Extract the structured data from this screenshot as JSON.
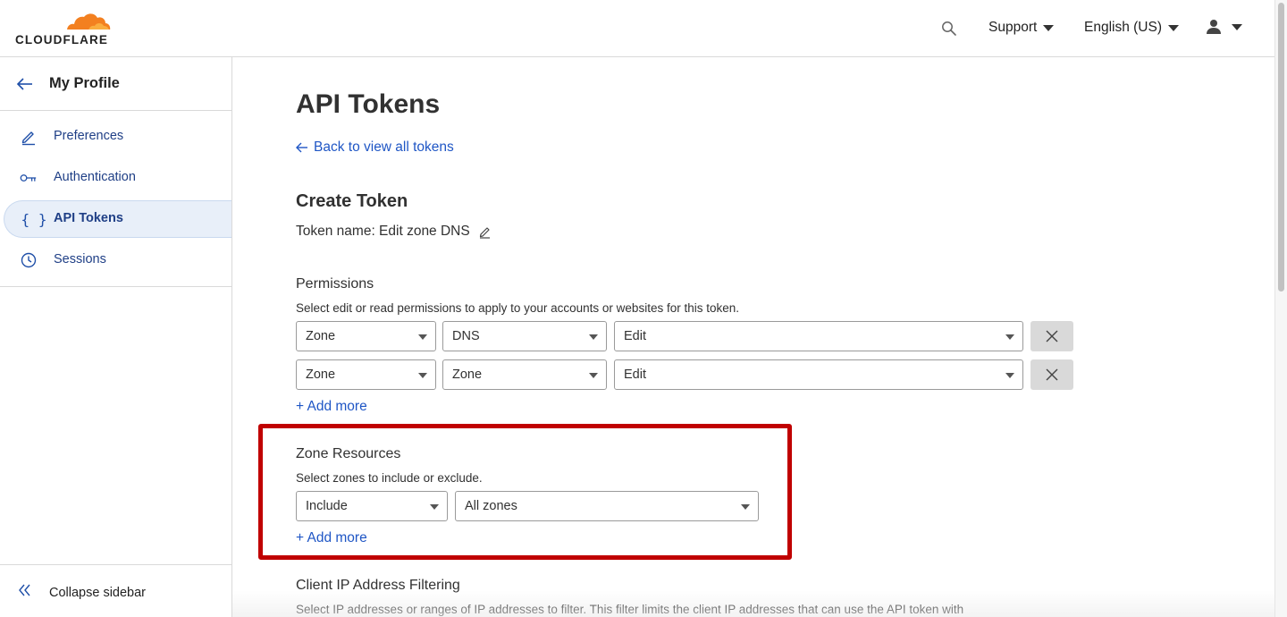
{
  "header": {
    "brand": "CLOUDFLARE",
    "support_label": "Support",
    "language_label": "English (US)",
    "icons": [
      "search-icon",
      "user-icon"
    ]
  },
  "sidebar": {
    "title": "My Profile",
    "items": [
      {
        "label": "Preferences",
        "icon": "pencil-icon",
        "active": false
      },
      {
        "label": "Authentication",
        "icon": "key-icon",
        "active": false
      },
      {
        "label": "API Tokens",
        "icon": "braces-icon",
        "active": true
      },
      {
        "label": "Sessions",
        "icon": "clock-icon",
        "active": false
      }
    ],
    "collapse_label": "Collapse sidebar"
  },
  "main": {
    "page_title": "API Tokens",
    "back_link": "Back to view all tokens",
    "section_title": "Create Token",
    "token_name": "Token name: Edit zone DNS",
    "permissions": {
      "label": "Permissions",
      "description": "Select edit or read permissions to apply to your accounts or websites for this token.",
      "rows": [
        {
          "scope": "Zone",
          "resource": "DNS",
          "access": "Edit"
        },
        {
          "scope": "Zone",
          "resource": "Zone",
          "access": "Edit"
        }
      ],
      "add_more": "+ Add more"
    },
    "zone_resources": {
      "label": "Zone Resources",
      "description": "Select zones to include or exclude.",
      "mode": "Include",
      "target": "All zones",
      "add_more": "+ Add more"
    },
    "client_ip": {
      "label": "Client IP Address Filtering",
      "description": "Select IP addresses or ranges of IP addresses to filter. This filter limits the client IP addresses that can use the API token with"
    }
  },
  "colors": {
    "link": "#1f56c5",
    "highlight": "#c00000",
    "brand_orange": "#f38020",
    "sidebar_active_bg": "#e8eff9"
  }
}
